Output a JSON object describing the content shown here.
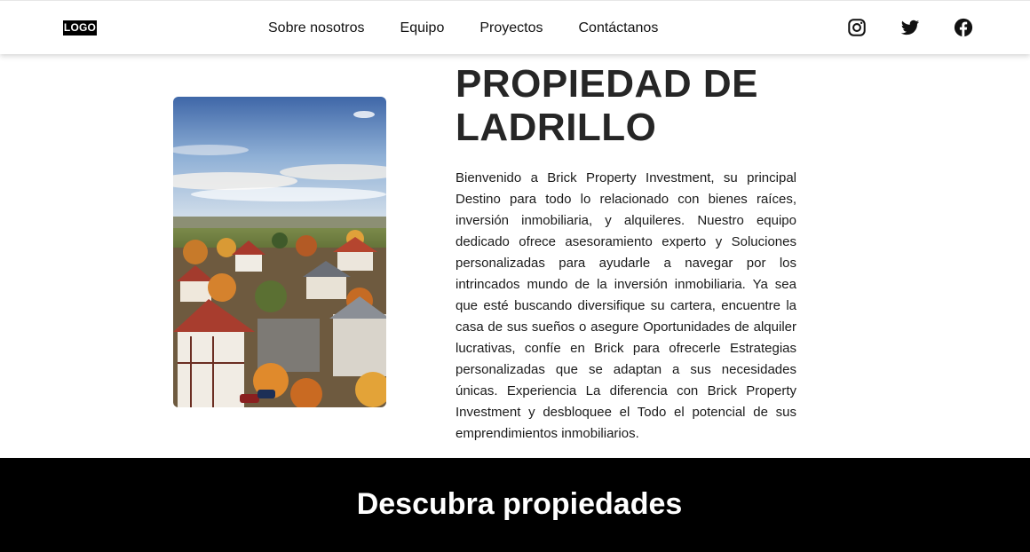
{
  "header": {
    "logo_text": "LOGO",
    "nav": [
      {
        "label": "Sobre nosotros"
      },
      {
        "label": "Equipo"
      },
      {
        "label": "Proyectos"
      },
      {
        "label": "Contáctanos"
      }
    ],
    "socials": [
      {
        "icon": "instagram-icon"
      },
      {
        "icon": "twitter-icon"
      },
      {
        "icon": "facebook-icon"
      }
    ]
  },
  "hero": {
    "image_subject": "aerial view of village with red-roofed houses and autumn trees",
    "title": "PROPIEDAD DE LADRILLO",
    "body": "Bienvenido a Brick Property Investment, su principal Destino para todo lo relacionado con bienes raíces, inversión inmobiliaria, y alquileres. Nuestro equipo dedicado ofrece asesoramiento experto y Soluciones personalizadas para ayudarle a navegar por los intrincados mundo de la inversión inmobiliaria. Ya sea que esté buscando diversifique su cartera, encuentre la casa de sus sueños o asegure Oportunidades de alquiler lucrativas, confíe en Brick para ofrecerle Estrategias personalizadas que se adaptan a sus necesidades únicas. Experiencia La diferencia con Brick Property Investment y desbloquee el Todo el potencial de sus emprendimientos inmobiliarios."
  },
  "section": {
    "title": "Descubra propiedades"
  },
  "colors": {
    "band_background": "#000000",
    "band_text": "#ffffff",
    "title_text": "#262626"
  }
}
